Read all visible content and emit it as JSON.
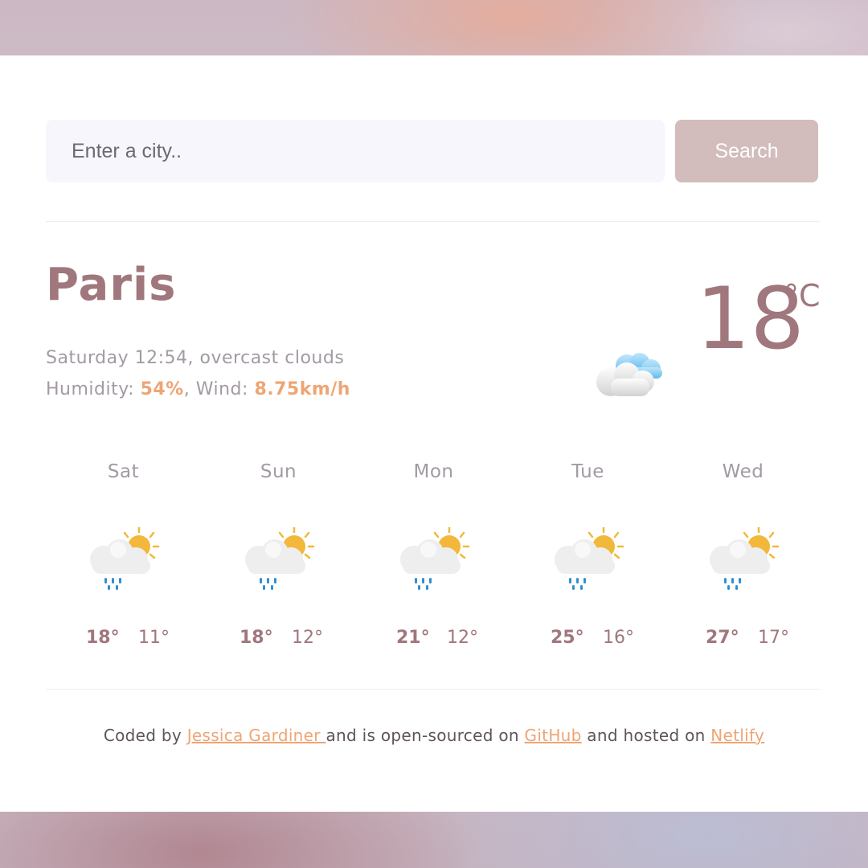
{
  "search": {
    "placeholder": "Enter a city..",
    "button_label": "Search"
  },
  "current": {
    "city": "Paris",
    "datetime_description": "Saturday 12:54, overcast clouds",
    "humidity_label": "Humidity: ",
    "humidity_value": "54%",
    "separator": ", ",
    "wind_label": "Wind: ",
    "wind_value": "8.75km/h",
    "temperature": "18",
    "unit": "°C",
    "icon": "overcast-clouds-icon"
  },
  "forecast": [
    {
      "day": "Sat",
      "max": "18°",
      "min": "11°",
      "icon": "sun-cloud-rain-icon"
    },
    {
      "day": "Sun",
      "max": "18°",
      "min": "12°",
      "icon": "sun-cloud-rain-icon"
    },
    {
      "day": "Mon",
      "max": "21°",
      "min": "12°",
      "icon": "sun-cloud-rain-icon"
    },
    {
      "day": "Tue",
      "max": "25°",
      "min": "16°",
      "icon": "sun-cloud-rain-icon"
    },
    {
      "day": "Wed",
      "max": "27°",
      "min": "17°",
      "icon": "sun-cloud-rain-icon"
    }
  ],
  "footer": {
    "text_1": "Coded by ",
    "author_link": "Jessica Gardiner ",
    "text_2": "and is open-sourced on ",
    "github_link": "GitHub",
    "text_3": " and hosted on ",
    "netlify_link": "Netlify"
  },
  "colors": {
    "primary": "#a0777c",
    "accent": "#eea574",
    "muted_text": "#a39aa3",
    "button_bg": "#d2bcbc",
    "input_bg": "#f6f6fc"
  }
}
